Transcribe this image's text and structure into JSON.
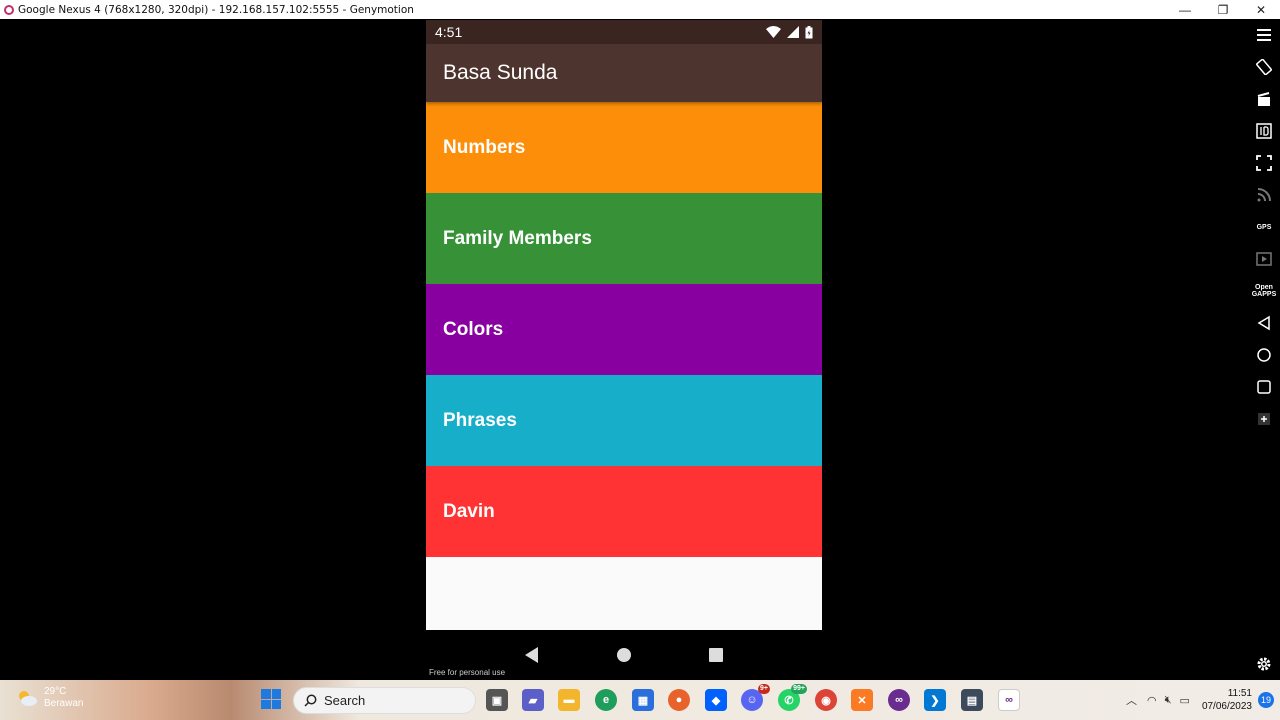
{
  "window": {
    "title": "Google Nexus 4 (768x1280, 320dpi) - 192.168.157.102:5555 - Genymotion",
    "minimize": "—",
    "maximize": "❐",
    "close": "✕"
  },
  "statusbar": {
    "time": "4:51"
  },
  "app": {
    "title": "Basa Sunda",
    "categories": [
      {
        "label": "Numbers",
        "color": "#fd8e09"
      },
      {
        "label": "Family Members",
        "color": "#379237"
      },
      {
        "label": "Colors",
        "color": "#8800a0"
      },
      {
        "label": "Phrases",
        "color": "#16aec9"
      },
      {
        "label": "Davin",
        "color": "#ff3334"
      }
    ]
  },
  "watermark": "Free for personal use",
  "sidebar": {
    "open_gapps": "Open GAPPS",
    "gps": "GPS"
  },
  "taskbar": {
    "weather_temp": "29°C",
    "weather_desc": "Berawan",
    "search_label": "Search",
    "discord_badge": "9+",
    "whatsapp_badge": "99+",
    "clock_time": "11:51",
    "clock_date": "07/06/2023",
    "notification_count": "19"
  }
}
